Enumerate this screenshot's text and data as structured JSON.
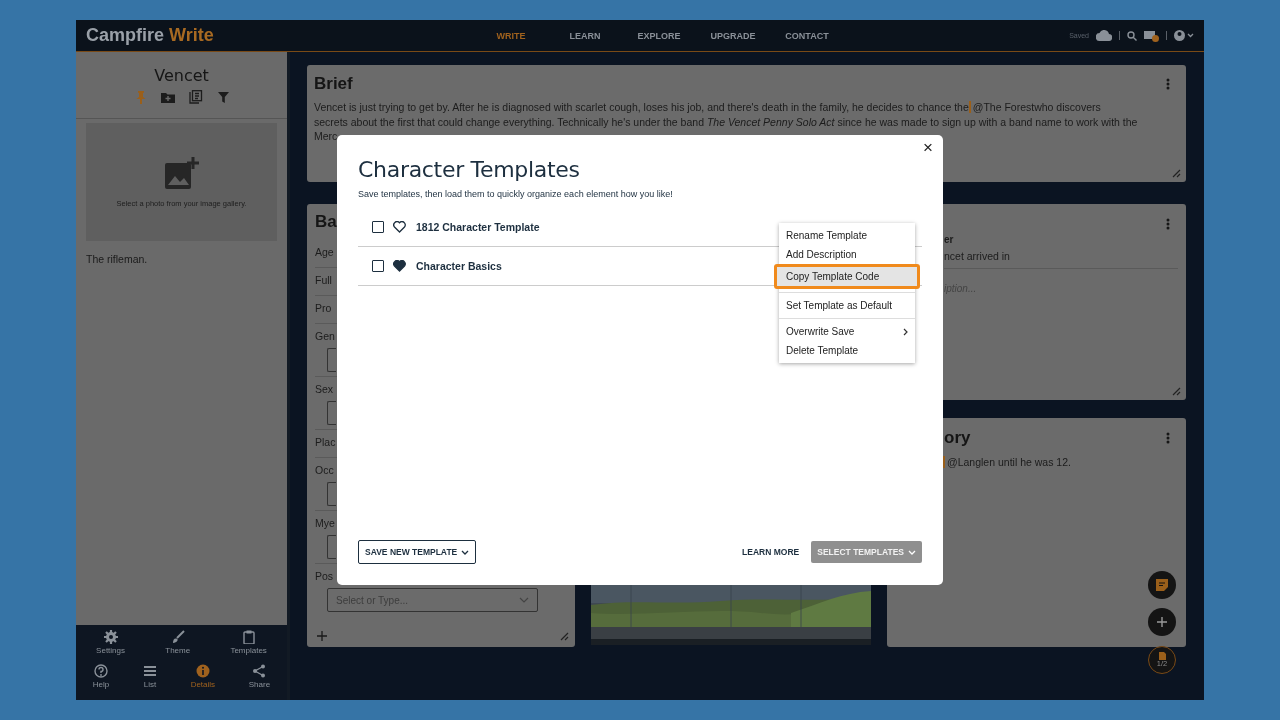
{
  "topbar": {
    "logo_first": "Campfire",
    "logo_second": "Write",
    "nav": [
      {
        "label": "WRITE",
        "selected": true
      },
      {
        "label": "LEARN",
        "selected": false
      },
      {
        "label": "EXPLORE",
        "selected": false
      },
      {
        "label": "UPGRADE",
        "selected": false
      },
      {
        "label": "CONTACT",
        "selected": false
      }
    ],
    "status": "Saved"
  },
  "sidebar": {
    "title": "Vencet",
    "tools": [
      {
        "kind": "pin",
        "active": true
      },
      {
        "kind": "folder",
        "active": false
      },
      {
        "kind": "gallery",
        "active": false
      },
      {
        "kind": "filter",
        "active": false
      }
    ],
    "photo_hint": "Select a photo from your image gallery.",
    "caption": "The rifleman.",
    "nav_rows": [
      [
        {
          "label": "Settings",
          "selected": false
        },
        {
          "label": "Theme",
          "selected": false
        },
        {
          "label": "Templates",
          "selected": false
        }
      ],
      [
        {
          "label": "Help",
          "selected": false
        },
        {
          "label": "List",
          "selected": false
        },
        {
          "label": "Details",
          "selected": true
        },
        {
          "label": "Share",
          "selected": false
        }
      ]
    ]
  },
  "brief": {
    "title": "Brief",
    "lines": [
      {
        "text": "Vencet is just trying to get by. After he is diagnosed with scarlet cough, loses his job, and there's death in the family, he decides to chance the",
        "mention": "@The Forest",
        "after": "who discovers"
      },
      {
        "text": "secrets about the first that could change everything. Technically he's under the band *The Vencet Penny Solo Act* since he was made to sign up with a band name to work with the"
      },
      {
        "text": "Merc"
      }
    ]
  },
  "basics": {
    "title": "Ba",
    "fields": [
      {
        "label": "Age",
        "kind": "line"
      },
      {
        "label": "Full",
        "kind": "line"
      },
      {
        "label": "Pro",
        "kind": "line"
      },
      {
        "label": "Gen",
        "kind": "input"
      },
      {
        "label": "Sex",
        "kind": "input"
      },
      {
        "label": "Plac",
        "kind": "line"
      },
      {
        "label": "Occ",
        "kind": "input"
      },
      {
        "label": "Mye",
        "kind": "input"
      },
      {
        "label": "Pos",
        "kind": "select",
        "placeholder": "Select or Type..."
      }
    ]
  },
  "right_card": {
    "heading": "er",
    "text": "ncet arrived in",
    "placeholder": "iption..."
  },
  "story": {
    "title": "ory",
    "mention": "@Langlen",
    "text": "until he was 12."
  },
  "page_counter": "1/2",
  "modal": {
    "close": "×",
    "title": "Character Templates",
    "subtitle": "Save templates, then load them to quickly organize each element how you like!",
    "templates": [
      {
        "name": "1812 Character Template",
        "checked": false,
        "favorite": false
      },
      {
        "name": "Character Basics",
        "checked": false,
        "favorite": true
      }
    ],
    "menu": [
      {
        "label": "Rename Template",
        "highlighted": false,
        "divider_after": false,
        "submenu": false
      },
      {
        "label": "Add Description",
        "highlighted": false,
        "divider_after": false,
        "submenu": false
      },
      {
        "label": "Copy Template Code",
        "highlighted": true,
        "divider_after": true,
        "submenu": false
      },
      {
        "label": "Set Template as Default",
        "highlighted": false,
        "divider_after": true,
        "submenu": false
      },
      {
        "label": "Overwrite Save",
        "highlighted": false,
        "divider_after": false,
        "submenu": true
      },
      {
        "label": "Delete Template",
        "highlighted": false,
        "divider_after": false,
        "submenu": false
      }
    ],
    "save_button": "SAVE NEW TEMPLATE",
    "learn_more": "LEARN MORE",
    "select_button": {
      "label": "SELECT TEMPLATES",
      "disabled": true
    }
  }
}
